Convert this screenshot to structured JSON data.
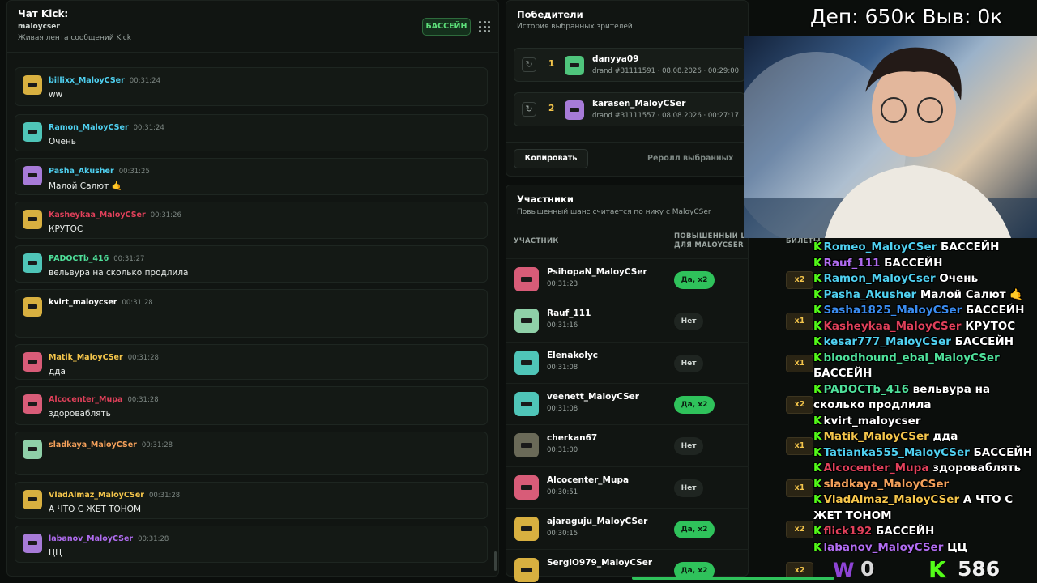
{
  "chat": {
    "title": "Чат Kick:",
    "channel": "maloycser",
    "subtitle": "Живая лента сообщений Kick",
    "pool_button": "БАССЕЙН",
    "messages": [
      {
        "user": "billixx_MaloyCSer",
        "time": "00:31:24",
        "text": "ww",
        "color": "#4fd0f0",
        "avatar": "#d8b040"
      },
      {
        "user": "Ramon_MaloyCSer",
        "time": "00:31:24",
        "text": "Очень",
        "color": "#4fd0f0",
        "avatar": "#4fc5b8"
      },
      {
        "user": "Pasha_Akusher",
        "time": "00:31:25",
        "text": "Малой Салют 🤙",
        "color": "#4fd0f0",
        "avatar": "#a77bd8"
      },
      {
        "user": "Kasheykaa_MaloyCSer",
        "time": "00:31:26",
        "text": "КРУТОС",
        "color": "#e0405a",
        "avatar": "#d8b040"
      },
      {
        "user": "PADOCTb_416",
        "time": "00:31:27",
        "text": "вельвура на сколько продлила",
        "color": "#4fe09a",
        "avatar": "#4fc5b8"
      },
      {
        "user": "kvirt_maloycser",
        "time": "00:31:28",
        "text": "",
        "color": "#ffffff",
        "avatar": "#d8b040"
      },
      {
        "user": "Matik_MaloyCSer",
        "time": "00:31:28",
        "text": "дда",
        "color": "#f4c54b",
        "avatar": "#d85c78"
      },
      {
        "user": "Alcocenter_Mupa",
        "time": "00:31:28",
        "text": "здороваблять",
        "color": "#e0405a",
        "avatar": "#d85c78"
      },
      {
        "user": "sladkaya_MaloyCSer",
        "time": "00:31:28",
        "text": "",
        "color": "#f4a05a",
        "avatar": "#8fd0a8"
      },
      {
        "user": "VladAlmaz_MaloyCSer",
        "time": "00:31:28",
        "text": "А ЧТО С ЖЕТ ТОНОМ",
        "color": "#f4c54b",
        "avatar": "#d8b040"
      },
      {
        "user": "labanov_MaloyCSer",
        "time": "00:31:28",
        "text": "ЦЦ",
        "color": "#b06cf0",
        "avatar": "#a77bd8"
      }
    ]
  },
  "winners": {
    "title": "Победители",
    "subtitle": "История выбранных зрителей",
    "rows": [
      {
        "num": "1",
        "name": "danyya09",
        "sub": "drand #31111591 · 08.08.2026 · 00:29:00",
        "avatar": "#4fc57c"
      },
      {
        "num": "2",
        "name": "karasen_MaloyCSer",
        "sub": "drand #31111557 · 08.08.2026 · 00:27:17",
        "avatar": "#a77bd8"
      }
    ],
    "copy": "Копировать",
    "reroll": "Реролл выбранных"
  },
  "participants": {
    "title": "Участники",
    "subtitle": "Повышенный шанс считается по нику с MaloyCSer",
    "col_participant": "УЧАСТНИК",
    "col_boost": "ПОВЫШЕННЫЙ ШАНС ДЛЯ MALOYCSER",
    "col_tickets": "БИЛЕТЫ",
    "rows": [
      {
        "name": "PsihopaN_MaloyCSer",
        "time": "00:31:23",
        "boost": "Да, x2",
        "yes": true,
        "tickets": "x2",
        "avatar": "#d85c78"
      },
      {
        "name": "Rauf_111",
        "time": "00:31:16",
        "boost": "Нет",
        "yes": false,
        "tickets": "x1",
        "avatar": "#8fd0a8"
      },
      {
        "name": "Elenakolyc",
        "time": "00:31:08",
        "boost": "Нет",
        "yes": false,
        "tickets": "x1",
        "avatar": "#4fc5b8"
      },
      {
        "name": "veenett_MaloyCSer",
        "time": "00:31:08",
        "boost": "Да, x2",
        "yes": true,
        "tickets": "x2",
        "avatar": "#4fc5b8"
      },
      {
        "name": "cherkan67",
        "time": "00:31:00",
        "boost": "Нет",
        "yes": false,
        "tickets": "x1",
        "avatar": "#6a6a58"
      },
      {
        "name": "Alcocenter_Mupa",
        "time": "00:30:51",
        "boost": "Нет",
        "yes": false,
        "tickets": "x1",
        "avatar": "#d85c78"
      },
      {
        "name": "ajaraguju_MaloyCSer",
        "time": "00:30:15",
        "boost": "Да, x2",
        "yes": true,
        "tickets": "x2",
        "avatar": "#d8b040"
      },
      {
        "name": "SergiO979_MaloyCSer",
        "time": "",
        "boost": "Да, x2",
        "yes": true,
        "tickets": "x2",
        "avatar": "#d8b040"
      }
    ]
  },
  "overlay": {
    "dep_text": "Деп: 650к Выв: 0к",
    "lines": [
      {
        "user": "Romeo_MaloyCSer",
        "color": "#4fd0f0",
        "text": "БАССЕЙН"
      },
      {
        "user": "Rauf_111",
        "color": "#b06cf0",
        "text": "БАССЕЙН"
      },
      {
        "user": "Ramon_MaloyCser",
        "color": "#4fd0f0",
        "text": "Очень"
      },
      {
        "user": "Pasha_Akusher",
        "color": "#4fd0f0",
        "text": "Малой Салют 🤙"
      },
      {
        "user": "Sasha1825_MaloyCSer",
        "color": "#3a8cf0",
        "text": "БАССЕЙН"
      },
      {
        "user": "Kasheykaa_MaloyCSer",
        "color": "#e0405a",
        "text": "КРУТОС"
      },
      {
        "user": "kesar777_MaloyCSer",
        "color": "#4fd0f0",
        "text": "БАССЕЙН"
      },
      {
        "user": "bloodhound_ebal_MaloyCSer",
        "color": "#4fe09a",
        "text": "БАССЕЙН"
      },
      {
        "user": "PADOCTb_416",
        "color": "#4fe09a",
        "text": "вельвура на сколько продлила"
      },
      {
        "user": "kvirt_maloycser",
        "color": "#ffffff",
        "text": ""
      },
      {
        "user": "Matik_MaloyCSer",
        "color": "#f4c54b",
        "text": "дда"
      },
      {
        "user": "Tatianka555_MaloyCSer",
        "color": "#4fd0f0",
        "text": "БАССЕЙН"
      },
      {
        "user": "Alcocenter_Mupa",
        "color": "#e0405a",
        "text": "здороваблять"
      },
      {
        "user": "sladkaya_MaloyCSer",
        "color": "#f4a05a",
        "text": ""
      },
      {
        "user": "VladAlmaz_MaloyCSer",
        "color": "#f4c54b",
        "text": "А ЧТО С ЖЕТ ТОНОМ"
      },
      {
        "user": "flick192",
        "color": "#e0405a",
        "text": "БАССЕЙН"
      },
      {
        "user": "labanov_MaloyCSer",
        "color": "#b06cf0",
        "text": "ЦЦ"
      }
    ],
    "w_count": "0",
    "k_count": "586"
  },
  "colors": {
    "accent": "#53fc18",
    "badge_green": "#2fc25b",
    "gold": "#f4c54b"
  },
  "icons": {
    "refresh": "refresh-icon",
    "grid": "grid-menu-icon",
    "kick": "kick-logo-icon"
  }
}
